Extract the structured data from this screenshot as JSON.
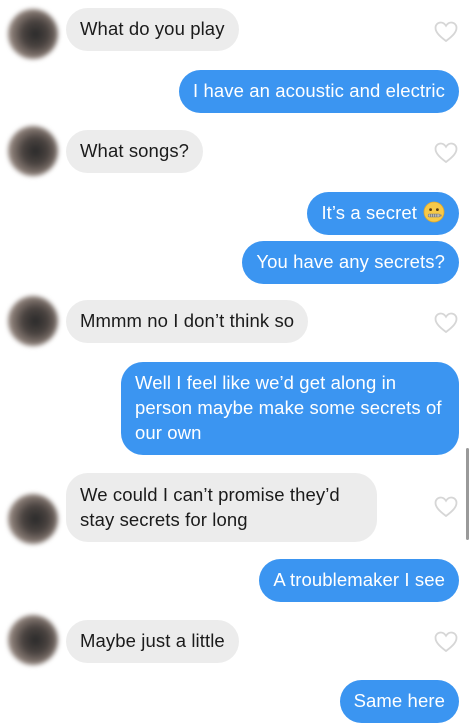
{
  "messages": [
    {
      "side": "in",
      "text": "What do you play",
      "liked": false
    },
    {
      "side": "out",
      "text": "I have an acoustic and electric"
    },
    {
      "side": "in",
      "text": "What songs?",
      "liked": false
    },
    {
      "side": "out",
      "text": "It’s a secret",
      "emoji": "zipper-mouth-face"
    },
    {
      "side": "out",
      "text": "You have any secrets?"
    },
    {
      "side": "in",
      "text": "Mmmm no I don’t think so",
      "liked": false
    },
    {
      "side": "out",
      "text": "Well I feel like we’d get along in person maybe make some secrets of our own"
    },
    {
      "side": "in",
      "text": "We could I can’t promise they’d stay secrets for long",
      "liked": false
    },
    {
      "side": "out",
      "text": "A troublemaker I see"
    },
    {
      "side": "in",
      "text": "Maybe just a little",
      "liked": false
    },
    {
      "side": "out",
      "text": "Same here"
    }
  ],
  "icons": {
    "like": "heart-outline-icon",
    "avatar": "blurred-profile-photo"
  },
  "colors": {
    "outgoing_bubble": "#3b95f1",
    "incoming_bubble": "#ececec",
    "incoming_text": "#1b1b1b",
    "outgoing_text": "#ffffff",
    "heart_outline": "#d6d6d6"
  }
}
